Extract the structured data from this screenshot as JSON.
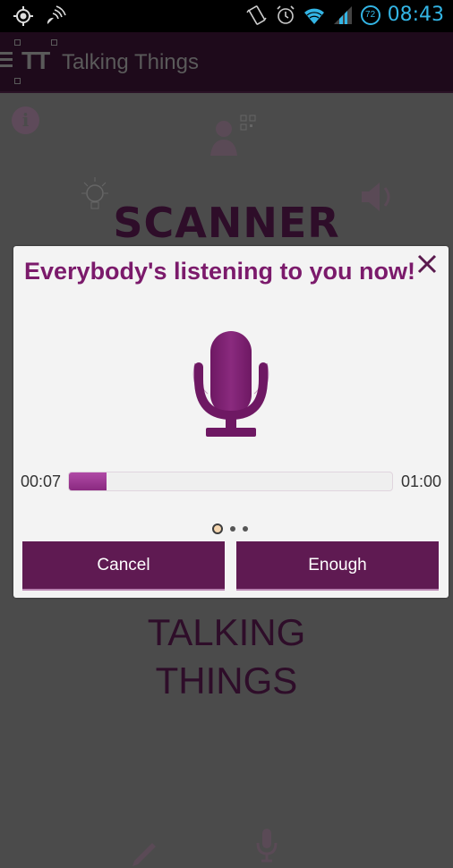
{
  "status_bar": {
    "time": "08:43",
    "battery_level": "72",
    "icons_left": [
      "gps-icon",
      "nfc-signal-icon"
    ],
    "icons_right": [
      "vibrate-icon",
      "alarm-icon",
      "wifi-icon",
      "cell-signal-icon",
      "battery-icon"
    ]
  },
  "action_bar": {
    "logo_text": "TT",
    "title": "Talking Things"
  },
  "background": {
    "scanner_label": "SCANNER",
    "talking_line1": "TALKING",
    "talking_line2": "THINGS",
    "info_glyph": "i"
  },
  "dialog": {
    "title": "Everybody's listening to you now!",
    "elapsed": "00:07",
    "total": "01:00",
    "progress_fraction": 0.117,
    "page_dots": 3,
    "active_dot": 0,
    "cancel_label": "Cancel",
    "enough_label": "Enough"
  },
  "colors": {
    "accent": "#7b1a6b",
    "button": "#5f1a52",
    "status_blue": "#33b5e5"
  }
}
